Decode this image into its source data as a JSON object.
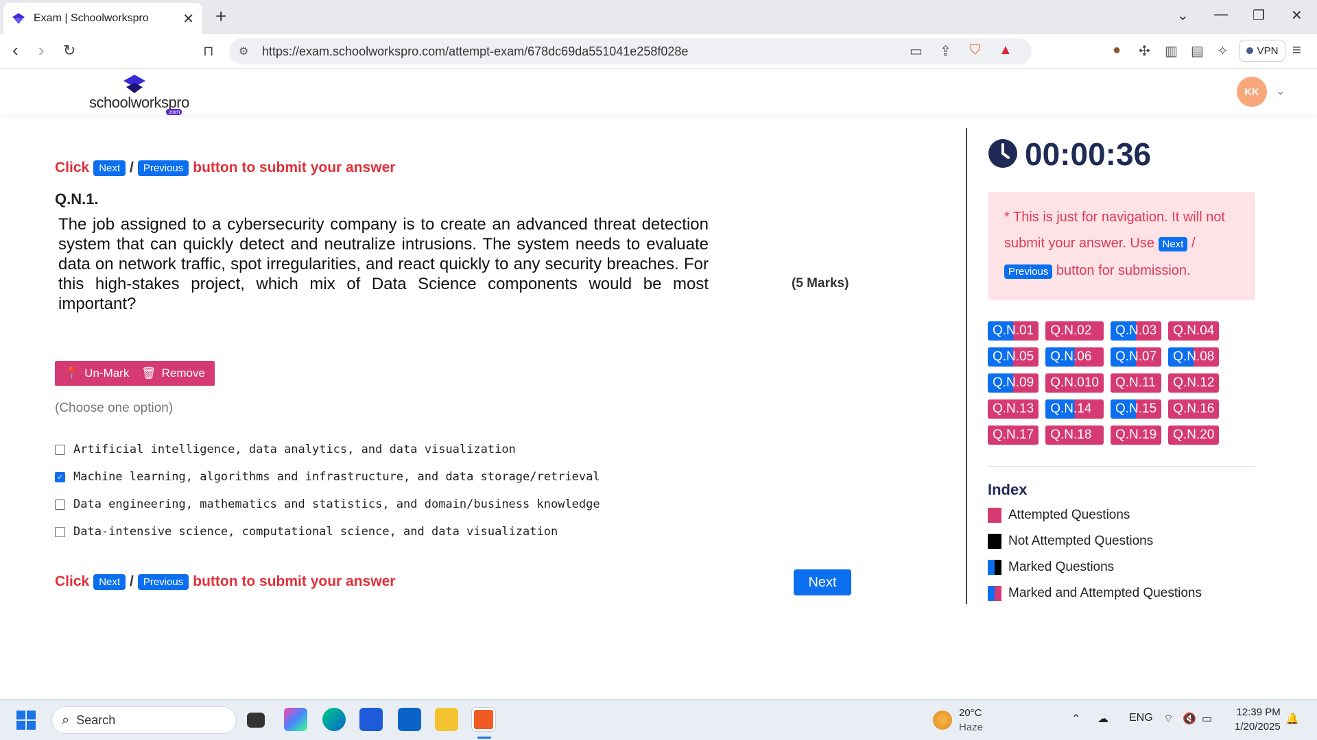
{
  "browser": {
    "tab_title": "Exam | Schoolworkspro",
    "url": "https://exam.schoolworkspro.com/attempt-exam/678dc69da551041e258f028e",
    "vpn_label": "VPN"
  },
  "header": {
    "logo_text": "schoolworkspro",
    "logo_sub": ".com",
    "avatar_initials": "KK"
  },
  "instructions": {
    "prefix": "Click",
    "next": "Next",
    "slash": "/",
    "previous": "Previous",
    "suffix": "button to submit your answer"
  },
  "question": {
    "number": "Q.N.1.",
    "text": "The job assigned to a cybersecurity company is to create an advanced threat detection system that can quickly detect and neutralize intrusions. The system needs to evaluate data on network traffic, spot irregularities, and react quickly to any security breaches. For this high-stakes project, which mix of Data Science components would be most important?",
    "marks": "(5 Marks)",
    "unmark_label": "Un-Mark",
    "remove_label": "Remove",
    "choose_hint": "(Choose one option)",
    "options": [
      {
        "label": "Artificial intelligence, data analytics, and data visualization",
        "checked": false
      },
      {
        "label": "Machine learning, algorithms and infrastructure, and data storage/retrieval",
        "checked": true
      },
      {
        "label": "Data engineering, mathematics and statistics, and domain/business knowledge",
        "checked": false
      },
      {
        "label": "Data-intensive science, computational science, and data visualization",
        "checked": false
      }
    ],
    "next_button": "Next"
  },
  "panel": {
    "timer": "00:00:36",
    "notice_part1": "* This is just for navigation. It will not submit your answer. Use",
    "notice_next": "Next",
    "notice_slash": "/",
    "notice_previous": "Previous",
    "notice_part2": "button for submission.",
    "questions": [
      {
        "label": "Q.N.01",
        "state": "split"
      },
      {
        "label": "Q.N.02",
        "state": "attempted"
      },
      {
        "label": "Q.N.03",
        "state": "split"
      },
      {
        "label": "Q.N.04",
        "state": "attempted"
      },
      {
        "label": "Q.N.05",
        "state": "split"
      },
      {
        "label": "Q.N.06",
        "state": "split"
      },
      {
        "label": "Q.N.07",
        "state": "split"
      },
      {
        "label": "Q.N.08",
        "state": "split"
      },
      {
        "label": "Q.N.09",
        "state": "split"
      },
      {
        "label": "Q.N.010",
        "state": "attempted"
      },
      {
        "label": "Q.N.11",
        "state": "attempted"
      },
      {
        "label": "Q.N.12",
        "state": "attempted"
      },
      {
        "label": "Q.N.13",
        "state": "attempted"
      },
      {
        "label": "Q.N.14",
        "state": "split"
      },
      {
        "label": "Q.N.15",
        "state": "split"
      },
      {
        "label": "Q.N.16",
        "state": "attempted"
      },
      {
        "label": "Q.N.17",
        "state": "attempted"
      },
      {
        "label": "Q.N.18",
        "state": "attempted"
      },
      {
        "label": "Q.N.19",
        "state": "attempted"
      },
      {
        "label": "Q.N.20",
        "state": "attempted"
      }
    ],
    "index_title": "Index",
    "legend": [
      {
        "label": "Attempted Questions",
        "kind": "attempted"
      },
      {
        "label": "Not Attempted Questions",
        "kind": "not-attempted"
      },
      {
        "label": "Marked Questions",
        "kind": "marked"
      },
      {
        "label": "Marked and Attempted Questions",
        "kind": "marked-attempted"
      }
    ]
  },
  "taskbar": {
    "search_placeholder": "Search",
    "weather_temp": "20°C",
    "weather_desc": "Haze",
    "language": "ENG",
    "time": "12:39 PM",
    "date": "1/20/2025"
  },
  "colors": {
    "accent_blue": "#0b6ff0",
    "attempted_pink": "#d63a72",
    "instruction_red": "#e0303a",
    "timer_navy": "#1f2a56"
  }
}
